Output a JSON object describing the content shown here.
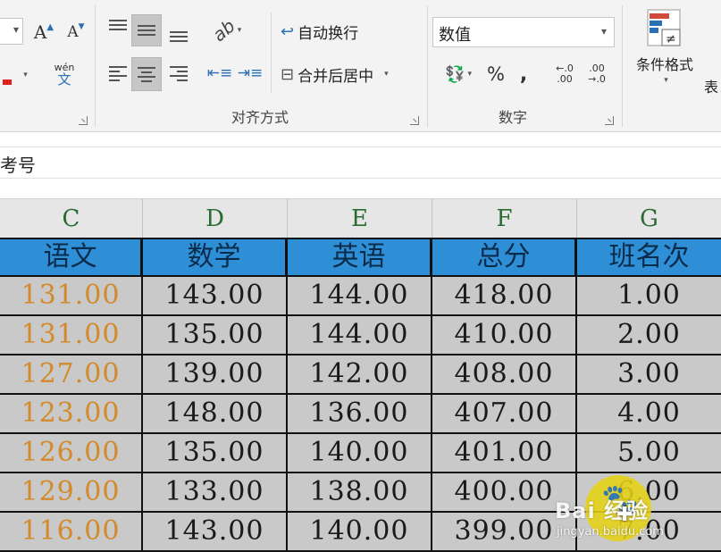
{
  "ribbon": {
    "font_group": {
      "grow_font_label": "A",
      "shrink_font_label": "A",
      "phonetic_label": "wén",
      "phonetic_sub": "文"
    },
    "alignment_group": {
      "label": "对齐方式",
      "wrap_text_label": "自动换行",
      "merge_center_label": "合并后居中"
    },
    "number_group": {
      "label": "数字",
      "format_value": "数值",
      "percent_label": "%",
      "comma_label": ",",
      "increase_decimal_label": "←.0 .00",
      "decrease_decimal_label": ".00 →.0"
    },
    "styles_group": {
      "conditional_format_label": "条件格式",
      "table_label": "表"
    }
  },
  "formula_bar": {
    "value": "考号"
  },
  "columns": [
    "C",
    "D",
    "E",
    "F",
    "G"
  ],
  "table": {
    "headers": [
      "语文",
      "数学",
      "英语",
      "总分",
      "班名次"
    ],
    "rows": [
      [
        "131.00",
        "143.00",
        "144.00",
        "418.00",
        "1.00"
      ],
      [
        "131.00",
        "135.00",
        "144.00",
        "410.00",
        "2.00"
      ],
      [
        "127.00",
        "139.00",
        "142.00",
        "408.00",
        "3.00"
      ],
      [
        "123.00",
        "148.00",
        "136.00",
        "407.00",
        "4.00"
      ],
      [
        "126.00",
        "135.00",
        "140.00",
        "401.00",
        "5.00"
      ],
      [
        "129.00",
        "133.00",
        "138.00",
        "400.00",
        "6.00"
      ],
      [
        "116.00",
        "143.00",
        "140.00",
        "399.00",
        "7.00"
      ]
    ]
  },
  "watermark": {
    "brand": "Bai 经验",
    "url": "jingyan.baidu.com"
  },
  "colors": {
    "header_fill": "#2f8fd6",
    "data_fill": "#c9c9c9",
    "chinese_score_text": "#d38a2b",
    "column_letter_text": "#2a6a33"
  }
}
